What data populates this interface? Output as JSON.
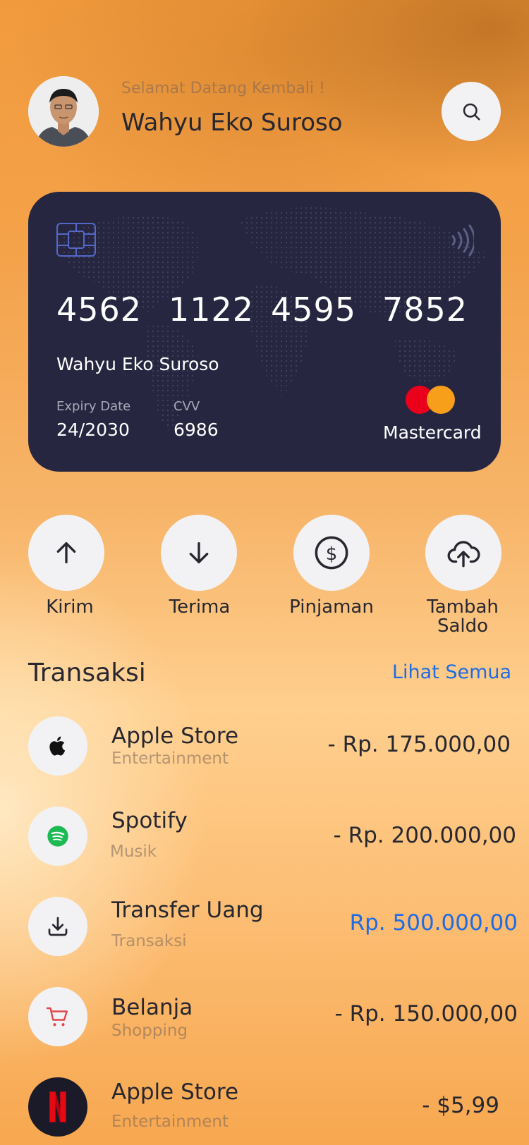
{
  "header": {
    "greeting": "Selamat Datang Kembali !",
    "user_name": "Wahyu Eko Suroso"
  },
  "card": {
    "number_groups": [
      "4562",
      "1122",
      "4595",
      "7852"
    ],
    "holder": "Wahyu Eko Suroso",
    "expiry_label": "Expiry Date",
    "expiry_value": "24/2030",
    "cvv_label": "CVV",
    "cvv_value": "6986",
    "brand": "Mastercard",
    "colors": {
      "background": "#262640",
      "mc_red": "#eb001b",
      "mc_orange": "#f79e1b"
    }
  },
  "actions": [
    {
      "label": "Kirim",
      "icon": "arrow-up-icon"
    },
    {
      "label": "Terima",
      "icon": "arrow-down-icon"
    },
    {
      "label": "Pinjaman",
      "icon": "dollar-circle-icon"
    },
    {
      "label": "Tambah\nSaldo",
      "icon": "cloud-upload-icon"
    }
  ],
  "transactions": {
    "title": "Transaksi",
    "see_all": "Lihat Semua",
    "items": [
      {
        "name": "Apple Store",
        "category": "Entertainment",
        "amount": "- Rp. 175.000,00",
        "icon": "apple-icon"
      },
      {
        "name": "Spotify",
        "category": "Musik",
        "amount": "- Rp. 200.000,00",
        "icon": "spotify-icon"
      },
      {
        "name": "Transfer Uang",
        "category": "Transaksi",
        "amount": "Rp. 500.000,00",
        "icon": "download-icon"
      },
      {
        "name": "Belanja",
        "category": "Shopping",
        "amount": "- Rp. 150.000,00",
        "icon": "cart-icon"
      },
      {
        "name": "Apple Store",
        "category": "Entertainment",
        "amount": "- $5,99",
        "icon": "netflix-icon"
      }
    ]
  },
  "colors": {
    "accent": "#1e6be6",
    "text": "#272730",
    "icon_bg": "#f2f2f4"
  }
}
